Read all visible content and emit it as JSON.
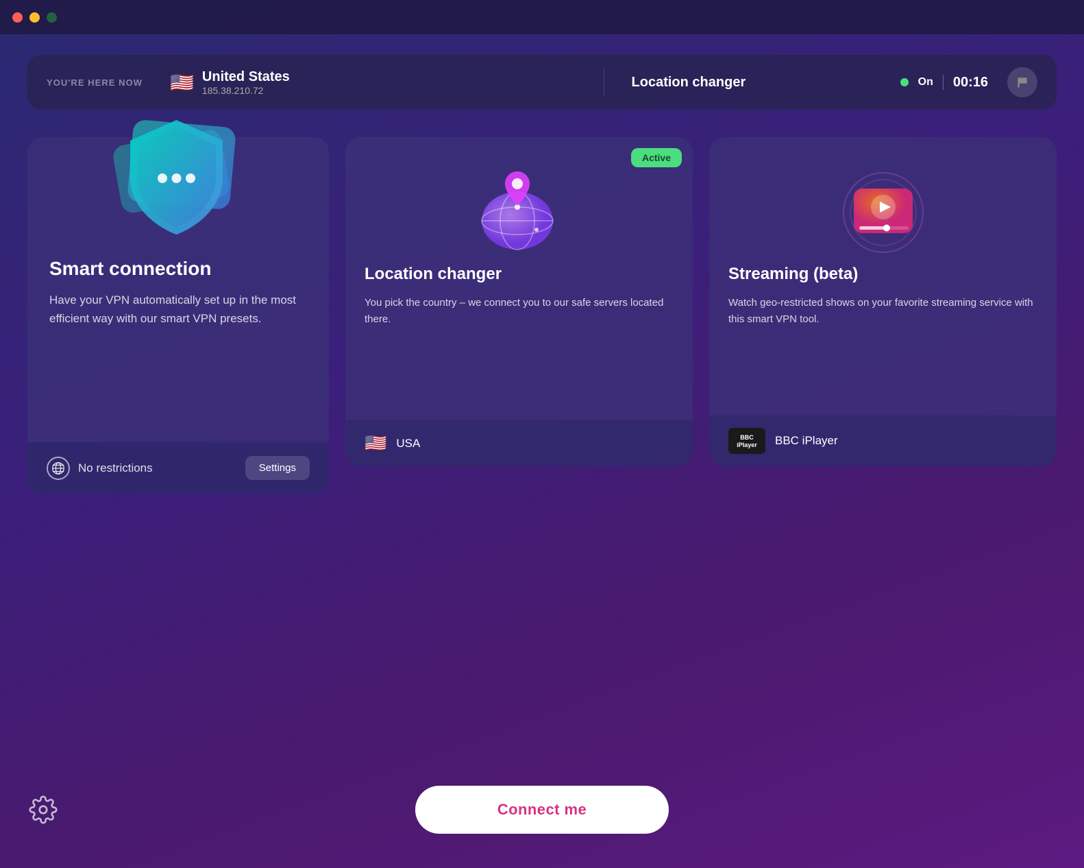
{
  "titlebar": {
    "close": "close",
    "minimize": "minimize",
    "maximize": "maximize"
  },
  "topbar": {
    "you_are_here": "YOU'RE HERE NOW",
    "country": "United States",
    "ip": "185.38.210.72",
    "feature": "Location changer",
    "status_on": "On",
    "status_time": "00:16"
  },
  "cards": {
    "smart": {
      "title": "Smart connection",
      "desc": "Have your VPN automatically set up in the most efficient way with our smart VPN presets.",
      "footer_label": "No restrictions",
      "settings_btn": "Settings"
    },
    "location": {
      "title": "Location changer",
      "desc": "You pick the country – we connect you to our safe servers located there.",
      "active_badge": "Active",
      "country_flag": "🇺🇸",
      "country_name": "USA"
    },
    "streaming": {
      "title": "Streaming (beta)",
      "desc": "Watch geo-restricted shows on your favorite streaming service with this smart VPN tool.",
      "service_name": "BBC iPlayer",
      "service_logo_line1": "BBC",
      "service_logo_line2": "iPlayer"
    }
  },
  "bottom": {
    "connect_btn": "Connect me",
    "settings_gear": "Settings gear"
  }
}
